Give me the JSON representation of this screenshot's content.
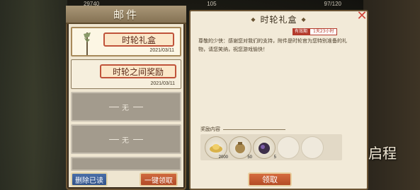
{
  "topbar": {
    "stat_1": "29740",
    "stat_2": "105",
    "stat_3": "97/120"
  },
  "mailbox": {
    "title": "邮件",
    "mails": [
      {
        "title": "时轮礼盒",
        "date": "2021/03/11"
      },
      {
        "title": "时轮之间奖励",
        "date": "2021/03/11"
      }
    ],
    "empty_label": "无",
    "delete_read_label": "删除已读",
    "claim_all_label": "一键领取"
  },
  "letter": {
    "title": "时轮礼盒",
    "expire_label": "有效期",
    "expire_value": "1天23小时",
    "body": "尊敬的少侠：感谢您对我们的支持，附件是时轮官为您特别准备的礼物，请您笑纳，祝您游戏愉快！",
    "reward_header": "奖励内容",
    "rewards": [
      {
        "icon": "gold-ingot-icon",
        "count": "2000"
      },
      {
        "icon": "pouch-icon",
        "count": "50"
      },
      {
        "icon": "spirit-pouch-icon",
        "count": "5"
      }
    ],
    "claim_label": "领取"
  },
  "side_logo": "启程",
  "colors": {
    "accent_red": "#b43a2c",
    "button_blue": "#31528a",
    "button_orange": "#b44c26",
    "paper": "#f2ead8"
  }
}
